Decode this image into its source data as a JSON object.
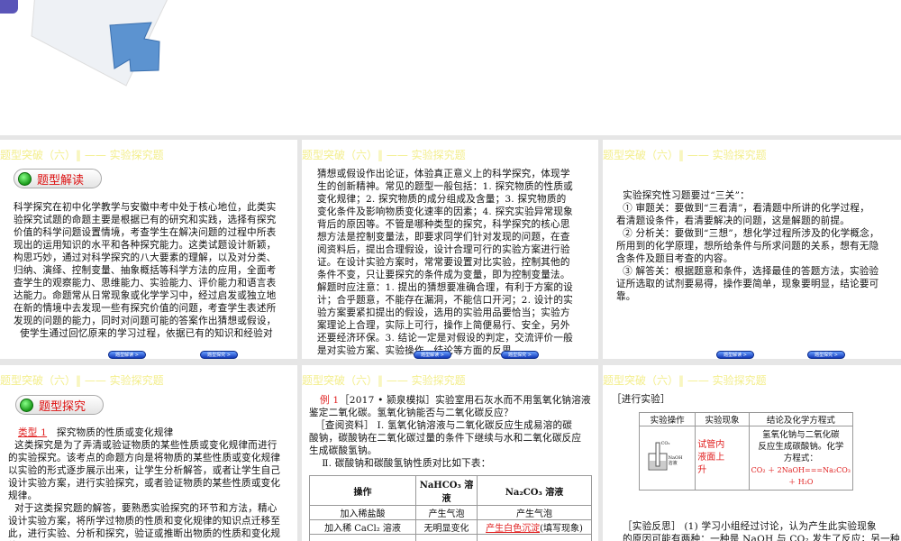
{
  "header": "题型突破（六）‖ —— 实验探究题",
  "nav_buttons": [
    "题型解读 >",
    "题型探究 >"
  ],
  "slide2": {
    "badge": "题型解读",
    "body": "科学探究在初中化学教学与安徽中考中处于核心地位，此类实\n验探究试题的命题主要是根据已有的研究和实践，选择有探究\n价值的科学问题设置情境，考查学生在解决问题的过程中所表\n现出的运用知识的水平和各种探究能力。这类试题设计新颖，\n构思巧妙，通过对科学探究的八大要素的理解，以及对分类、\n归纳、演绎、控制变量、抽象概括等科学方法的应用，全面考\n查学生的观察能力、思维能力、实验能力、评价能力和语言表\n达能力。命题常从日常现象或化学学习中，经过启发或独立地\n在新的情境中去发现一些有探究价值的问题，考查学生表述所\n发现的问题的能力，同时对问题可能的答案作出猜想或假设，\n  使学生通过回忆原来的学习过程，依据已有的知识和经验对"
  },
  "slide3": {
    "body": "猜想或假设作出论证，体验真正意义上的科学探究，体现学\n生的创新精神。常见的题型一般包括：1. 探究物质的性质或\n变化规律；2. 探究物质的成分组成及含量；3. 探究物质的\n变化条件及影响物质变化速率的因素；4. 探究实验异常现象\n背后的原因等。不管是哪种类型的探究，科学探究的核心思\n想方法是控制变量法，即要求同学们针对发现的问题，在查\n阅资料后，提出合理假设，设计合理可行的实验方案进行验\n证。在设计实验方案时，常常要设置对比实验，控制其他的\n条件不变，只让要探究的条件成为变量，即为控制变量法。\n解题时应注意：1. 提出的猜想要准确合理，有利于方案的设\n计；合乎题意，不能存在漏洞，不能信口开河；2. 设计的实\n验方案要紧扣提出的假设，选用的实验用品要恰当；实验方\n案理论上合理，实际上可行，操作上简便易行、安全，另外\n还要经济环保。3. 结论一定是对假设的判定，交流评价一般\n是对实验方案、实验操作、结论等方面的反思。"
  },
  "slide4": {
    "body": "  实验探究性习题要过“三关”：\n  ① 审题关：要做到“三看清”，看清题中所讲的化学过程，\n看清题设条件，看清要解决的问题，这是解题的前提。\n  ② 分析关：要做到“三想”，想化学过程所涉及的化学概念，\n所用到的化学原理，想所给条件与所求问题的关系，想有无隐\n含条件及题目考查的内容。\n  ③ 解答关：根据题意和条件，选择最佳的答题方法，实验验\n证所选取的试剂要易得，操作要简单，现象要明显，结论要可\n靠。"
  },
  "slide5": {
    "badge": "题型探究",
    "type_label": "类型 1",
    "type_title": "探究物质的性质或变化规律",
    "body": "  这类探究是为了弄清或验证物质的某些性质或变化规律而进行\n的实验探究。该考点的命题方向是将物质的某些性质或变化规律\n以实验的形式逐步展示出来，让学生分析解答，或者让学生自己\n设计实验方案，进行实验探究，或者验证物质的某些性质或变化\n规律。\n  对于这类探究题的解答，要熟悉实验探究的环节和方法，精心\n设计实验方案，将所学过物质的性质和变化规律的知识点迁移至\n此，进行实验、分析和探究，验证或推断出物质的性质和变化规\n律。"
  },
  "slide6": {
    "example_label": "例 1",
    "body": "［2017 • 颍泉模拟］实验室用石灰水而不用氢氧化钠溶液\n鉴定二氧化碳。氢氧化钠能否与二氧化碳反应？\n  ［查阅资料］ Ⅰ. 氢氧化钠溶液与二氧化碳反应生成易溶的碳\n酸钠，碳酸钠在二氧化碳过量的条件下继续与水和二氧化碳反应\n生成碳酸氢钠。\n    Ⅱ. 碳酸钠和碳酸氢钠性质对比如下表：",
    "table": {
      "headers": [
        "操作",
        "NaHCO₃ 溶液",
        "Na₂CO₃ 溶液"
      ],
      "rows": [
        [
          "加入稀盐酸",
          "产生气泡",
          "产生气泡"
        ],
        [
          "加入稀 CaCl₂ 溶液",
          "无明显变化",
          "(填写现象)"
        ]
      ],
      "answer": "产生白色沉淀"
    }
  },
  "slide7": {
    "section": "［进行实验］",
    "table": {
      "headers": [
        "实验操作",
        "实验现象",
        "结论及化学方程式"
      ],
      "phenomenon": "试管内\n液面上\n升",
      "conclusion": "氢氧化钠与二氧化碳\n反应生成碳酸钠。化学\n方程式：",
      "equation": "CO₂ ＋ 2NaOH===Na₂CO₃\n＋ H₂O",
      "apparatus_labels": [
        "CO₂",
        "NaOH\n溶液"
      ]
    },
    "reflection": "［实验反思］ (1) 学习小组经过讨论，认为产生此实验现象\n的原因可能有两种：一种是 NaOH 与 CO₂ 发生了反应；另一种"
  }
}
